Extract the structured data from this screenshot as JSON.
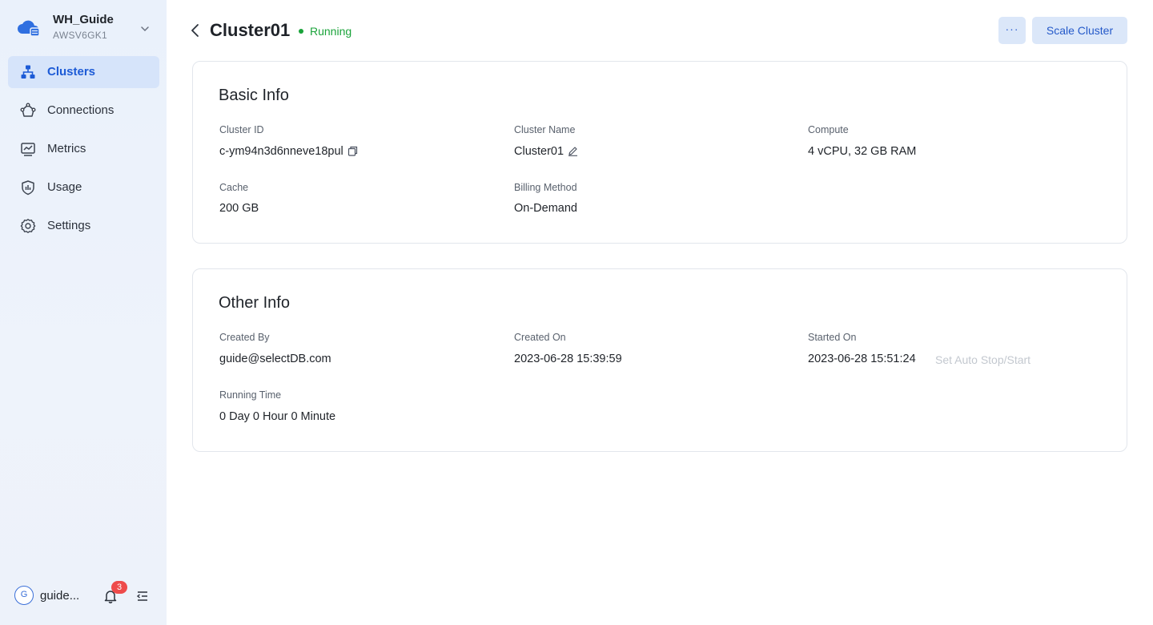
{
  "workspace": {
    "name": "WH_Guide",
    "id": "AWSV6GK1"
  },
  "sidebar": {
    "items": [
      {
        "label": "Clusters",
        "icon": "clusters-icon",
        "active": true
      },
      {
        "label": "Connections",
        "icon": "connections-icon"
      },
      {
        "label": "Metrics",
        "icon": "metrics-icon"
      },
      {
        "label": "Usage",
        "icon": "usage-icon"
      },
      {
        "label": "Settings",
        "icon": "gear-icon"
      }
    ]
  },
  "user": {
    "initial": "G",
    "name": "guide...",
    "notifications": "3"
  },
  "header": {
    "title": "Cluster01",
    "status": "Running",
    "more_label": "···",
    "scale_label": "Scale Cluster"
  },
  "basic_info": {
    "title": "Basic Info",
    "fields": [
      {
        "label": "Cluster ID",
        "value": "c-ym94n3d6nneve18pul"
      },
      {
        "label": "Cluster Name",
        "value": "Cluster01"
      },
      {
        "label": "Compute",
        "value": "4 vCPU, 32 GB RAM"
      },
      {
        "label": "Cache",
        "value": "200 GB"
      },
      {
        "label": "Billing Method",
        "value": "On-Demand"
      }
    ]
  },
  "other_info": {
    "title": "Other Info",
    "fields": [
      {
        "label": "Created By",
        "value": "guide@selectDB.com"
      },
      {
        "label": "Created On",
        "value": "2023-06-28 15:39:59"
      },
      {
        "label": "Started On",
        "value": "2023-06-28 15:51:24"
      },
      {
        "label": "Running Time",
        "value": "0 Day 0 Hour 0 Minute"
      }
    ],
    "auto_stop_link": "Set Auto Stop/Start"
  },
  "colors": {
    "accent": "#1d5bd6",
    "running": "#1aa33a",
    "badge": "#ee4b4b",
    "button_bg": "#dbe7f9"
  }
}
